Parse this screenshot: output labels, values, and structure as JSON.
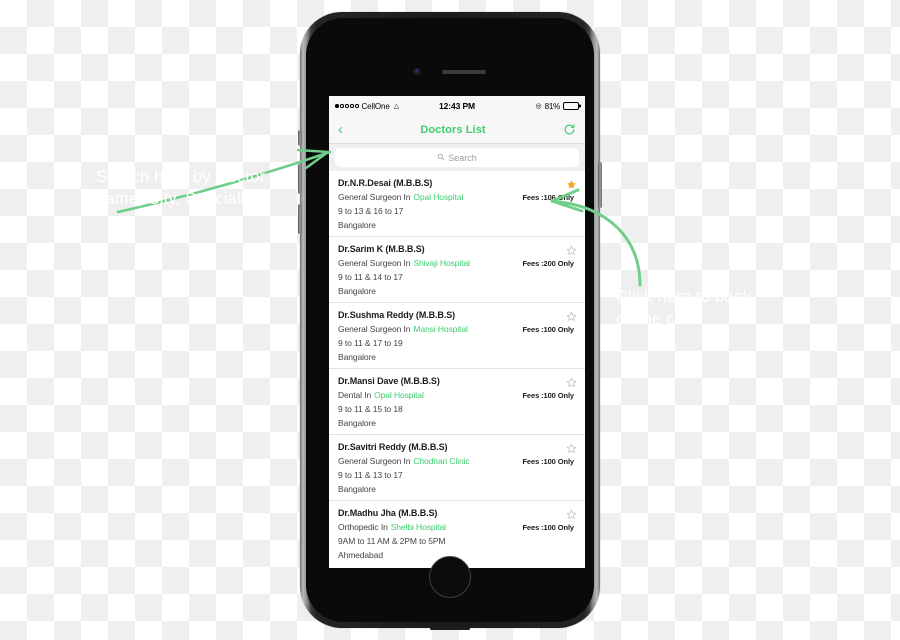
{
  "status_bar": {
    "carrier": "CellOne",
    "signal_dots_filled": 1,
    "signal_dots_total": 5,
    "wifi_icon": "wifi-icon",
    "time": "12:43 PM",
    "bluetooth_icon": "bluetooth-icon",
    "battery_percent": "81%",
    "battery_level": 81
  },
  "nav_bar": {
    "back_icon": "back-chevron-icon",
    "title": "Doctors List",
    "refresh_icon": "refresh-icon",
    "accent_color": "#3ECE6F"
  },
  "search": {
    "placeholder": "Search",
    "value": "",
    "icon": "search-icon"
  },
  "list": {
    "fees_prefix": "Fees :",
    "doctors": [
      {
        "name": "Dr.N.R.Desai (M.B.B.S)",
        "specialty": "General Surgeon In",
        "hospital": "Opal Hospital",
        "fees": "Fees :106 Only",
        "hours": "9 to 13 & 16 to 17",
        "city": "Bangalore",
        "favorite": true,
        "star_icon": "star-filled-icon"
      },
      {
        "name": "Dr.Sarim K (M.B.B.S)",
        "specialty": "General Surgeon In",
        "hospital": "Shivaji Hospital",
        "fees": "Fees :200 Only",
        "hours": "9 to 11 & 14 to 17",
        "city": "Bangalore",
        "favorite": false,
        "star_icon": "star-outline-icon"
      },
      {
        "name": "Dr.Sushma Reddy (M.B.B.S)",
        "specialty": "General Surgeon In",
        "hospital": "Mansi Hospital",
        "fees": "Fees :100 Only",
        "hours": "9 to 11 & 17 to 19",
        "city": "Bangalore",
        "favorite": false,
        "star_icon": "star-outline-icon"
      },
      {
        "name": "Dr.Mansi Dave (M.B.B.S)",
        "specialty": "Dental In",
        "hospital": "Opal Hospital",
        "fees": "Fees :100 Only",
        "hours": "9 to 11 & 15 to 18",
        "city": "Bangalore",
        "favorite": false,
        "star_icon": "star-outline-icon"
      },
      {
        "name": "Dr.Savitri Reddy (M.B.B.S)",
        "specialty": "General Surgeon In",
        "hospital": "Chodhari Clinic",
        "fees": "Fees :100 Only",
        "hours": "9 to 11 & 13 to 17",
        "city": "Bangalore",
        "favorite": false,
        "star_icon": "star-outline-icon"
      },
      {
        "name": "Dr.Madhu Jha (M.B.B.S)",
        "specialty": "Orthopedic In",
        "hospital": "Shelbi Hospital",
        "fees": "Fees :100 Only",
        "hours": "9AM to 11 AM & 2PM to 5PM",
        "city": "Ahmedabad",
        "favorite": false,
        "star_icon": "star-outline-icon"
      }
    ]
  },
  "annotations": {
    "left_text": "Search here by Doctor\nname, City, Specialist",
    "right_text": "Click here to book\nonline case",
    "arrow_color": "#6FCF8A",
    "text_color": "#FFFFFF"
  },
  "colors": {
    "accent_green": "#3ECE6F",
    "star_gold": "#F5A623",
    "search_bg": "#EFEFF4",
    "nav_bg": "#F7F7F7"
  }
}
